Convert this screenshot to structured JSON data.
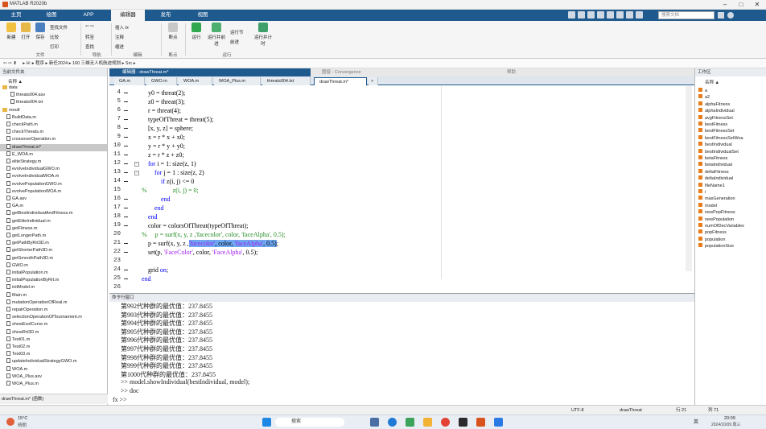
{
  "app": {
    "title": "MATLAB R2020b"
  },
  "ribbon_tabs": [
    "主页",
    "绘图",
    "APP",
    "编辑器",
    "发布",
    "视图"
  ],
  "active_tab": "编辑器",
  "search_placeholder": "搜索文档",
  "ribbon": {
    "file": {
      "new": "新建",
      "open": "打开",
      "save": "保存",
      "find_file": "查找文件",
      "compare": "比较",
      "print": "打印",
      "group": "文件"
    },
    "nav": {
      "goto": "转至",
      "find": "查找",
      "group": "导航"
    },
    "edit": {
      "insert": "插入",
      "comment": "注释",
      "indent": "缩进",
      "group": "编辑"
    },
    "breakpoints": {
      "label": "断点",
      "group": "断点"
    },
    "run": {
      "run": "运行",
      "run_advance": "运行并前进",
      "run_section": "运行节",
      "advance": "前进",
      "run_time": "运行并计时",
      "group": "运行"
    }
  },
  "path": "▸ H: ▸ 程序 ▸ 新任2024 ▸ 160 三维无人机航迹规划 ▸ Src ▸",
  "left_panel": {
    "title": "当前文件夹",
    "col_header": "名称 ▲",
    "items": [
      {
        "name": "data",
        "type": "folder",
        "indent": 0
      },
      {
        "name": "threats004.asv",
        "type": "file",
        "indent": 2
      },
      {
        "name": "threats004.txt",
        "type": "file",
        "indent": 2
      },
      {
        "name": "result",
        "type": "folder",
        "indent": 0
      },
      {
        "name": "BuildData.m",
        "type": "file",
        "indent": 1
      },
      {
        "name": "checkPath.m",
        "type": "file",
        "indent": 1
      },
      {
        "name": "checkThreats.m",
        "type": "file",
        "indent": 1
      },
      {
        "name": "crossoverOperation.m",
        "type": "file",
        "indent": 1
      },
      {
        "name": "drawThreat.m*",
        "type": "file",
        "indent": 1,
        "selected": true
      },
      {
        "name": "E_WOA.m",
        "type": "file",
        "indent": 1
      },
      {
        "name": "eliteStrategy.m",
        "type": "file",
        "indent": 1
      },
      {
        "name": "evolveIndividualGWO.m",
        "type": "file",
        "indent": 1
      },
      {
        "name": "evolveIndividualWOA.m",
        "type": "file",
        "indent": 1
      },
      {
        "name": "evolvePopulationGWO.m",
        "type": "file",
        "indent": 1
      },
      {
        "name": "evolvePopulationWOA.m",
        "type": "file",
        "indent": 1
      },
      {
        "name": "GA.asv",
        "type": "file",
        "indent": 1
      },
      {
        "name": "GA.m",
        "type": "file",
        "indent": 1
      },
      {
        "name": "getBestIndividualAndFitness.m",
        "type": "file",
        "indent": 1
      },
      {
        "name": "getEliteIndividual.m",
        "type": "file",
        "indent": 1
      },
      {
        "name": "getFitness.m",
        "type": "file",
        "indent": 1
      },
      {
        "name": "getLongerPath.m",
        "type": "file",
        "indent": 1
      },
      {
        "name": "getPathByRrt3D.m",
        "type": "file",
        "indent": 1
      },
      {
        "name": "getShorterPath3D.m",
        "type": "file",
        "indent": 1
      },
      {
        "name": "getSmoothPath3D.m",
        "type": "file",
        "indent": 1
      },
      {
        "name": "GWO.m",
        "type": "file",
        "indent": 1
      },
      {
        "name": "initialPopulation.m",
        "type": "file",
        "indent": 1
      },
      {
        "name": "initialPopulationByRrt.m",
        "type": "file",
        "indent": 1
      },
      {
        "name": "initModel.m",
        "type": "file",
        "indent": 1
      },
      {
        "name": "Main.m",
        "type": "file",
        "indent": 1
      },
      {
        "name": "mutationOperationOfReal.m",
        "type": "file",
        "indent": 1
      },
      {
        "name": "repairOperation.m",
        "type": "file",
        "indent": 1
      },
      {
        "name": "selectionOperationOfTournament.m",
        "type": "file",
        "indent": 1
      },
      {
        "name": "showEvolCurve.m",
        "type": "file",
        "indent": 1
      },
      {
        "name": "showRrt3D.m",
        "type": "file",
        "indent": 1
      },
      {
        "name": "Test01.m",
        "type": "file",
        "indent": 1
      },
      {
        "name": "Test02.m",
        "type": "file",
        "indent": 1
      },
      {
        "name": "Test03.m",
        "type": "file",
        "indent": 1
      },
      {
        "name": "updateIndividualStrategyGWO.m",
        "type": "file",
        "indent": 1
      },
      {
        "name": "WOA.m",
        "type": "file",
        "indent": 1
      },
      {
        "name": "WOA_Plus.asv",
        "type": "file",
        "indent": 1
      },
      {
        "name": "WOA_Plus.m",
        "type": "file",
        "indent": 1
      }
    ],
    "footer": "drawThreat.m* (函数)"
  },
  "editor": {
    "header": "编辑器 - drawThreat.m*",
    "conv_header": "图窗 - Convergence",
    "help_header": "帮助",
    "tabs": [
      "GA.m",
      "GWO.m",
      "WOA.m",
      "WOA_Plus.m",
      "threats004.txt",
      "drawThreat.m*"
    ],
    "active_tab": "drawThreat.m*",
    "lines": [
      {
        "n": "4",
        "dash": true,
        "code": "    y0 = threat(2);"
      },
      {
        "n": "5",
        "dash": true,
        "code": "    z0 = threat(3);"
      },
      {
        "n": "6",
        "dash": true,
        "code": "    r = threat(4);"
      },
      {
        "n": "7",
        "dash": true,
        "code": "    typeOfThreat = threat(5);"
      },
      {
        "n": "8",
        "dash": true,
        "code": "    [x, y, z] = sphere;"
      },
      {
        "n": "9",
        "dash": true,
        "code": "    x = r * x + x0;"
      },
      {
        "n": "10",
        "dash": true,
        "code": "    y = r * y + y0;"
      },
      {
        "n": "11",
        "dash": true,
        "code": "    z = r * z + z0;"
      },
      {
        "n": "12",
        "dash": true,
        "code": "    for i = 1: size(z, 1)"
      },
      {
        "n": "13",
        "dash": true,
        "code": "        for j = 1 : size(z, 2)"
      },
      {
        "n": "14",
        "dash": true,
        "code": "            if z(i, j) <= 0"
      },
      {
        "n": "15",
        "dash": false,
        "code": "%                z(i, j) = 0;"
      },
      {
        "n": "16",
        "dash": true,
        "code": "            end"
      },
      {
        "n": "17",
        "dash": true,
        "code": "        end"
      },
      {
        "n": "18",
        "dash": true,
        "code": "    end"
      },
      {
        "n": "19",
        "dash": true,
        "code": "    color = colorsOfThreat(typeOfThreat);"
      },
      {
        "n": "20",
        "dash": false,
        "code": "%     p = surf(x, y, z ,'facecolor', color, 'faceAlpha', 0.5);"
      },
      {
        "n": "21",
        "dash": true,
        "code": "    p = surf(x, y, z ,'facecolor', color, 'faceAlpha', 0.5);"
      },
      {
        "n": "22",
        "dash": true,
        "code": "    set(p, 'FaceColor', color, 'FaceAlpha', 0.5);"
      },
      {
        "n": "23",
        "dash": false,
        "code": ""
      },
      {
        "n": "24",
        "dash": true,
        "code": "    grid on;"
      },
      {
        "n": "25",
        "dash": true,
        "code": "end"
      },
      {
        "n": "26",
        "dash": false,
        "code": ""
      }
    ]
  },
  "command_window": {
    "title": "命令行窗口",
    "lines": [
      "第992代种群的最优值：237.8455",
      "第993代种群的最优值：237.8455",
      "第994代种群的最优值：237.8455",
      "第995代种群的最优值：237.8455",
      "第996代种群的最优值：237.8455",
      "第997代种群的最优值：237.8455",
      "第998代种群的最优值：237.8455",
      "第999代种群的最优值：237.8455",
      "第1000代种群的最优值：237.8455",
      ">> model.showIndividual(bestIndividual, model);",
      ">> doc"
    ],
    "prompt": "fx >>"
  },
  "workspace": {
    "title": "工作区",
    "col_header": "名称 ▲",
    "vars": [
      "a",
      "a2",
      "alphaFitness",
      "alphaIndividual",
      "avgFitnessSet",
      "bestFitness",
      "bestFitnessSet",
      "bestFitnessSetWoa",
      "bestIndividual",
      "bestIndividualSet",
      "betaFitness",
      "betaIndividual",
      "deltaFitness",
      "deltaIndividual",
      "fileName1",
      "i",
      "maxGeneration",
      "model",
      "newPopFitness",
      "newPopulation",
      "numOfDecVariables",
      "popFitness",
      "population",
      "populationSize"
    ]
  },
  "status": {
    "encoding": "UTF-8",
    "script": "drawThreat",
    "ln": "行 21",
    "col": "列 71"
  },
  "taskbar": {
    "weather_temp": "15°C",
    "weather_desc": "晴朗",
    "search": "搜索",
    "time": "20:09",
    "date": "2024/10/09 周三",
    "ime": "英"
  }
}
